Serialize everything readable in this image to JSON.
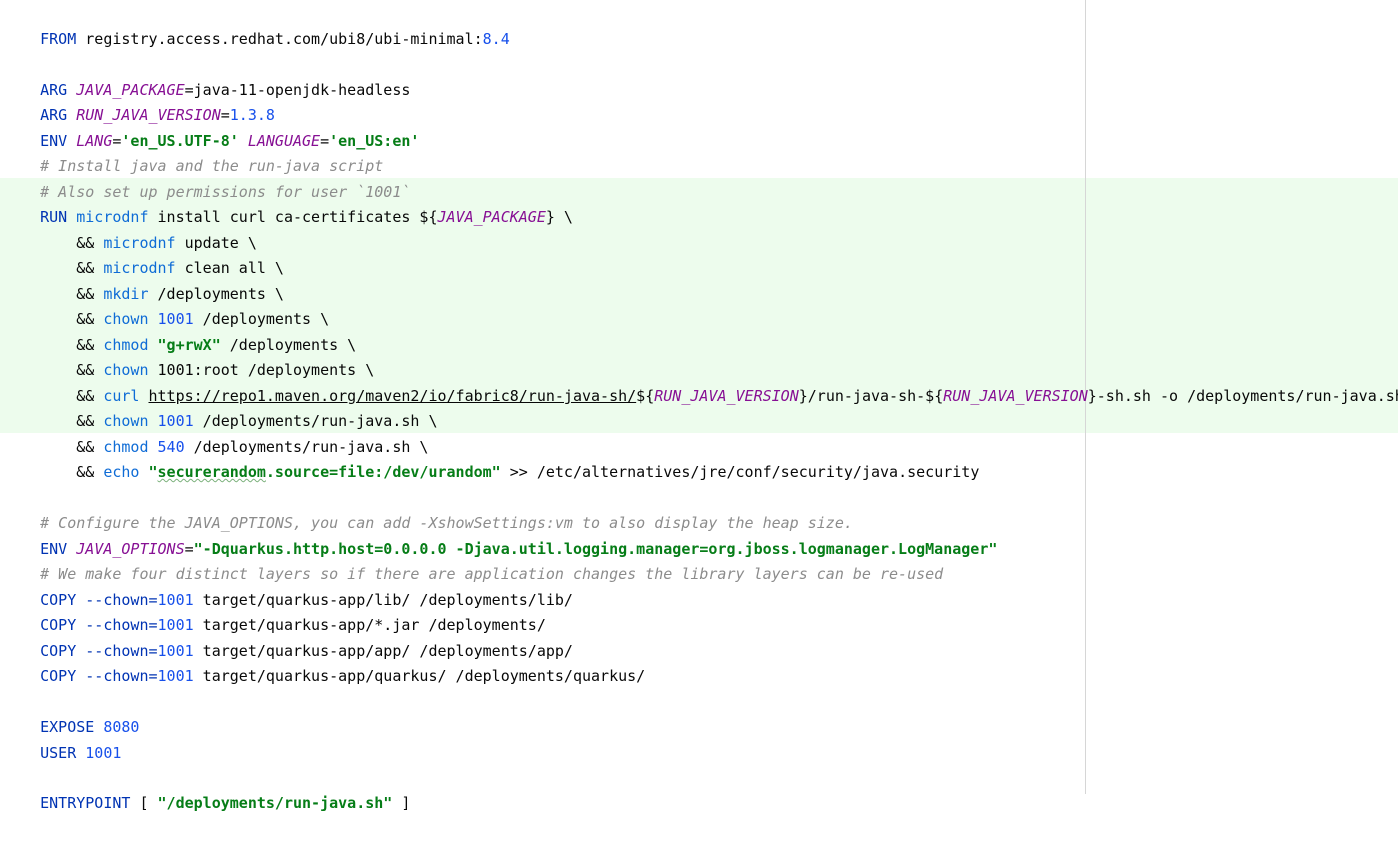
{
  "lines": {
    "l1": [
      "FROM",
      " registry.access.redhat.com/ubi8/ubi-minimal:",
      "8.4"
    ],
    "l3": [
      "ARG",
      " ",
      "JAVA_PACKAGE",
      "=java-11-openjdk-headless"
    ],
    "l4": [
      "ARG",
      " ",
      "RUN_JAVA_VERSION",
      "=",
      "1.3.8"
    ],
    "l5": [
      "ENV",
      " ",
      "LANG",
      "=",
      "'en_US.UTF-8'",
      " ",
      "LANGUAGE",
      "=",
      "'en_US:en'"
    ],
    "l6": [
      "# Install java and the run-java script"
    ],
    "l7": [
      "# Also set up permissions for user `1001`"
    ],
    "l8": [
      "RUN",
      " ",
      "microdnf",
      " install curl ca-certificates ${",
      "JAVA_PACKAGE",
      "} \\"
    ],
    "l9": [
      "    && ",
      "microdnf",
      " update \\"
    ],
    "l10": [
      "    && ",
      "microdnf",
      " clean all \\"
    ],
    "l11": [
      "    && ",
      "mkdir",
      " /deployments \\"
    ],
    "l12": [
      "    && ",
      "chown",
      " ",
      "1001",
      " /deployments \\"
    ],
    "l13": [
      "    && ",
      "chmod",
      " ",
      "\"g+rwX\"",
      " /deployments \\"
    ],
    "l14": [
      "    && ",
      "chown",
      " 1001:root /deployments \\"
    ],
    "l15": [
      "    && ",
      "curl",
      " ",
      "https://repo1.maven.org/maven2/io/fabric8/run-java-sh/",
      "${",
      "RUN_JAVA_VERSION",
      "}/run-java-sh-${",
      "RUN_JAVA_VERSION",
      "}-sh.sh -o /deployments/run-java.sh \\"
    ],
    "l16": [
      "    && ",
      "chown",
      " ",
      "1001",
      " /deployments/run-java.sh \\"
    ],
    "l17": [
      "    && ",
      "chmod",
      " ",
      "540",
      " /deployments/run-java.sh \\"
    ],
    "l18": [
      "    && ",
      "echo",
      " ",
      "\"",
      "securerandom",
      ".source=file:/dev/urandom\"",
      " >> /etc/alternatives/jre/conf/security/java.security"
    ],
    "l20": [
      "# Configure the JAVA_OPTIONS, you can add -XshowSettings:vm to also display the heap size."
    ],
    "l21": [
      "ENV",
      " ",
      "JAVA_OPTIONS",
      "=",
      "\"-Dquarkus.http.host=0.0.0.0 -Djava.util.logging.manager=org.jboss.logmanager.LogManager\""
    ],
    "l22": [
      "# We make four distinct layers so if there are application changes the library layers can be re-used"
    ],
    "l23": [
      "COPY",
      " --chown=",
      "1001",
      " target/quarkus-app/lib/ /deployments/lib/"
    ],
    "l24": [
      "COPY",
      " --chown=",
      "1001",
      " target/quarkus-app/*.jar /deployments/"
    ],
    "l25": [
      "COPY",
      " --chown=",
      "1001",
      " target/quarkus-app/app/ /deployments/app/"
    ],
    "l26": [
      "COPY",
      " --chown=",
      "1001",
      " target/quarkus-app/quarkus/ /deployments/quarkus/"
    ],
    "l28": [
      "EXPOSE",
      " ",
      "8080"
    ],
    "l29": [
      "USER",
      " ",
      "1001"
    ],
    "l31": [
      "ENTRYPOINT",
      " [ ",
      "\"/deployments/run-java.sh\"",
      " ]"
    ]
  },
  "colors": {
    "keyword": "#0033b3",
    "variable": "#871094",
    "string": "#067d17",
    "number": "#1750eb",
    "comment": "#8c8c8c",
    "command": "#0f6cd6",
    "changed_block_bg": "#edfced"
  }
}
